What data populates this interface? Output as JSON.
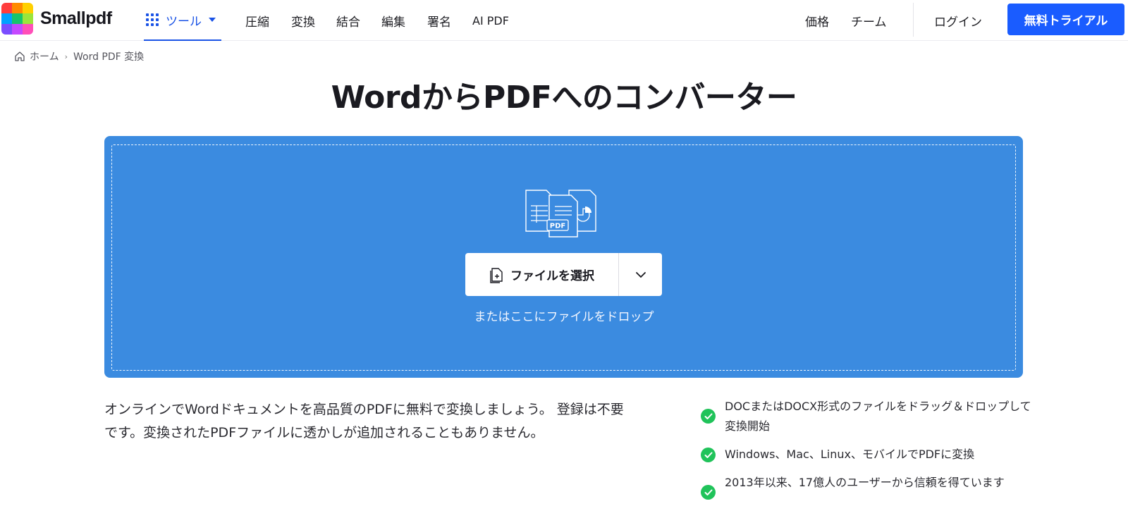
{
  "header": {
    "brand": "Smallpdf",
    "tools_label": "ツール",
    "nav": [
      "圧縮",
      "変換",
      "結合",
      "編集",
      "署名",
      "AI PDF"
    ],
    "right_nav": [
      "価格",
      "チーム"
    ],
    "login": "ログイン",
    "cta": "無料トライアル"
  },
  "breadcrumb": {
    "home": "ホーム",
    "current": "Word PDF 変換"
  },
  "page": {
    "title": "WordからPDFへのコンバーター"
  },
  "dropzone": {
    "badge": "PDF",
    "choose_label": "ファイルを選択",
    "hint": "またはここにファイルをドロップ"
  },
  "description": "オンラインでWordドキュメントを高品質のPDFに無料で変換しましょう。 登録は不要です。変換されたPDFファイルに透かしが追加されることもありません。",
  "features": [
    "DOCまたはDOCX形式のファイルをドラッグ＆ドロップして変換開始",
    "Windows、Mac、Linux、モバイルでPDFに変換",
    "2013年以来、17億人のユーザーから信頼を得ています"
  ],
  "colors": {
    "accent": "#1a5cff",
    "dropzone": "#3b8be0",
    "check": "#20c35a"
  }
}
